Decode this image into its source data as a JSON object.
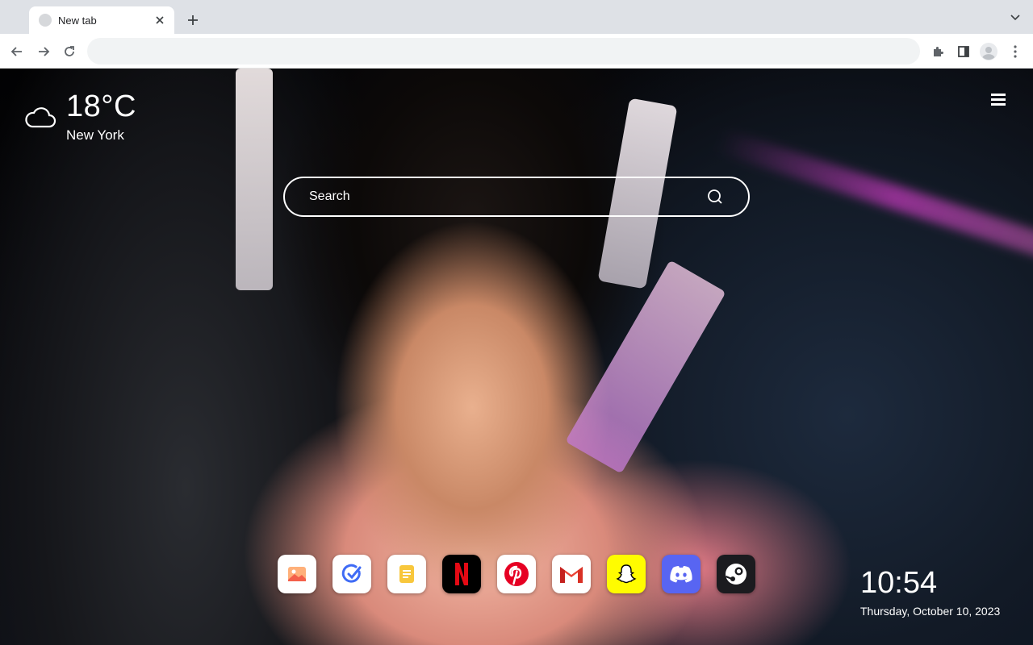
{
  "browser": {
    "tab": {
      "title": "New tab"
    },
    "omnibox": {
      "value": "",
      "placeholder": ""
    }
  },
  "weather": {
    "temperature": "18°C",
    "city": "New York",
    "icon": "cloud-icon"
  },
  "search": {
    "placeholder": "Search"
  },
  "shortcuts": [
    {
      "name": "Photos",
      "icon": "gallery-icon",
      "color": "#ffffff"
    },
    {
      "name": "Todo",
      "icon": "check-circle-icon",
      "color": "#ffffff"
    },
    {
      "name": "Notes",
      "icon": "notes-icon",
      "color": "#ffffff"
    },
    {
      "name": "Netflix",
      "icon": "netflix-icon",
      "color": "#000000"
    },
    {
      "name": "Pinterest",
      "icon": "pinterest-icon",
      "color": "#ffffff"
    },
    {
      "name": "Gmail",
      "icon": "gmail-icon",
      "color": "#ffffff"
    },
    {
      "name": "Snapchat",
      "icon": "snapchat-icon",
      "color": "#fffc00"
    },
    {
      "name": "Discord",
      "icon": "discord-icon",
      "color": "#5865f2"
    },
    {
      "name": "Steam",
      "icon": "steam-icon",
      "color": "#1b1b1f"
    }
  ],
  "clock": {
    "time": "10:54",
    "date": "Thursday, October 10, 2023"
  }
}
